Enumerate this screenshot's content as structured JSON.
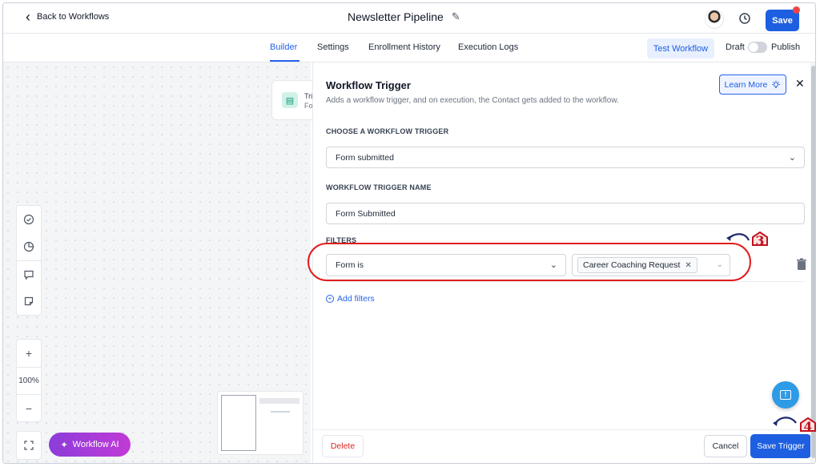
{
  "topbar": {
    "back_label": "Back to Workflows",
    "title": "Newsletter Pipeline",
    "save_label": "Save"
  },
  "tabs": {
    "items": [
      "Builder",
      "Settings",
      "Enrollment History",
      "Execution Logs"
    ],
    "active": "Builder",
    "test_workflow": "Test Workflow",
    "draft": "Draft",
    "publish": "Publish"
  },
  "canvas": {
    "node_line1": "Tri",
    "node_line2": "Fo",
    "zoom_level": "100%",
    "workflow_ai": "Workflow AI"
  },
  "panel": {
    "title": "Workflow Trigger",
    "subtitle": "Adds a workflow trigger, and on execution, the Contact gets added to the workflow.",
    "learn_more": "Learn More",
    "choose_label": "CHOOSE A WORKFLOW TRIGGER",
    "trigger_value": "Form submitted",
    "name_label": "WORKFLOW TRIGGER NAME",
    "name_value": "Form Submitted",
    "filters_label": "FILTERS",
    "filter_field": "Form is",
    "filter_chip": "Career Coaching Request",
    "add_filters": "Add filters",
    "delete": "Delete",
    "cancel": "Cancel",
    "save_trigger": "Save Trigger"
  },
  "annotations": {
    "step_a": "3",
    "step_b": "4"
  },
  "colors": {
    "primary": "#1d5fe0",
    "annotation_red": "#e11d1d",
    "ai_gradient_start": "#8b3dd9",
    "ai_gradient_end": "#c13ad6"
  }
}
